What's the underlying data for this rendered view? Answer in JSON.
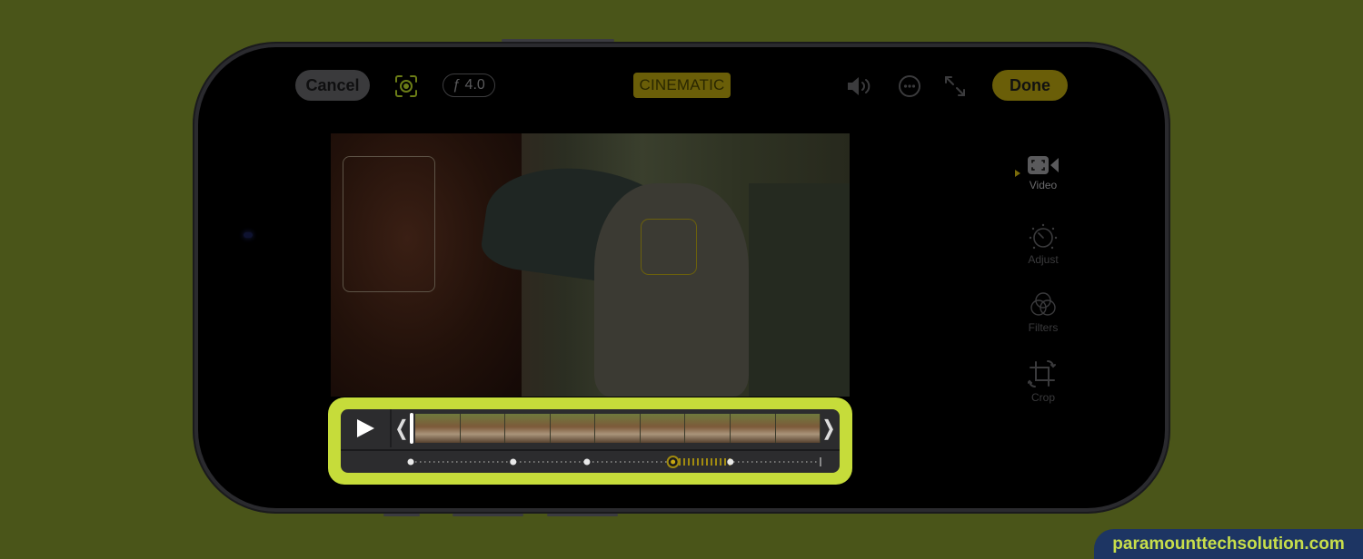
{
  "topbar": {
    "cancel_label": "Cancel",
    "aperture_label": "ƒ 4.0",
    "mode_badge": "CINEMATIC",
    "done_label": "Done",
    "icons": [
      "focus-lock-icon",
      "speaker-icon",
      "more-icon",
      "expand-icon"
    ]
  },
  "sidebar": {
    "items": [
      {
        "label": "Video",
        "icon": "video-camera-icon",
        "selected": true
      },
      {
        "label": "Adjust",
        "icon": "adjust-dial-icon",
        "selected": false
      },
      {
        "label": "Filters",
        "icon": "filters-icon",
        "selected": false
      },
      {
        "label": "Crop",
        "icon": "crop-rotate-icon",
        "selected": false
      }
    ]
  },
  "timeline": {
    "play_icon": "play-icon",
    "trim_left": "❬",
    "trim_right": "❭",
    "frame_count": 9,
    "focus_points": [
      0.0,
      0.25,
      0.43,
      0.64,
      0.78
    ],
    "selected_focus_point": 0.64,
    "end_marker": 1.0
  },
  "colors": {
    "accent_yellow": "#6a5e08",
    "highlight_green": "#c6dc3a",
    "background": "#4a5519",
    "watermark_bg": "#1d3563"
  },
  "watermark": {
    "text": "paramounttechsolution.com"
  }
}
